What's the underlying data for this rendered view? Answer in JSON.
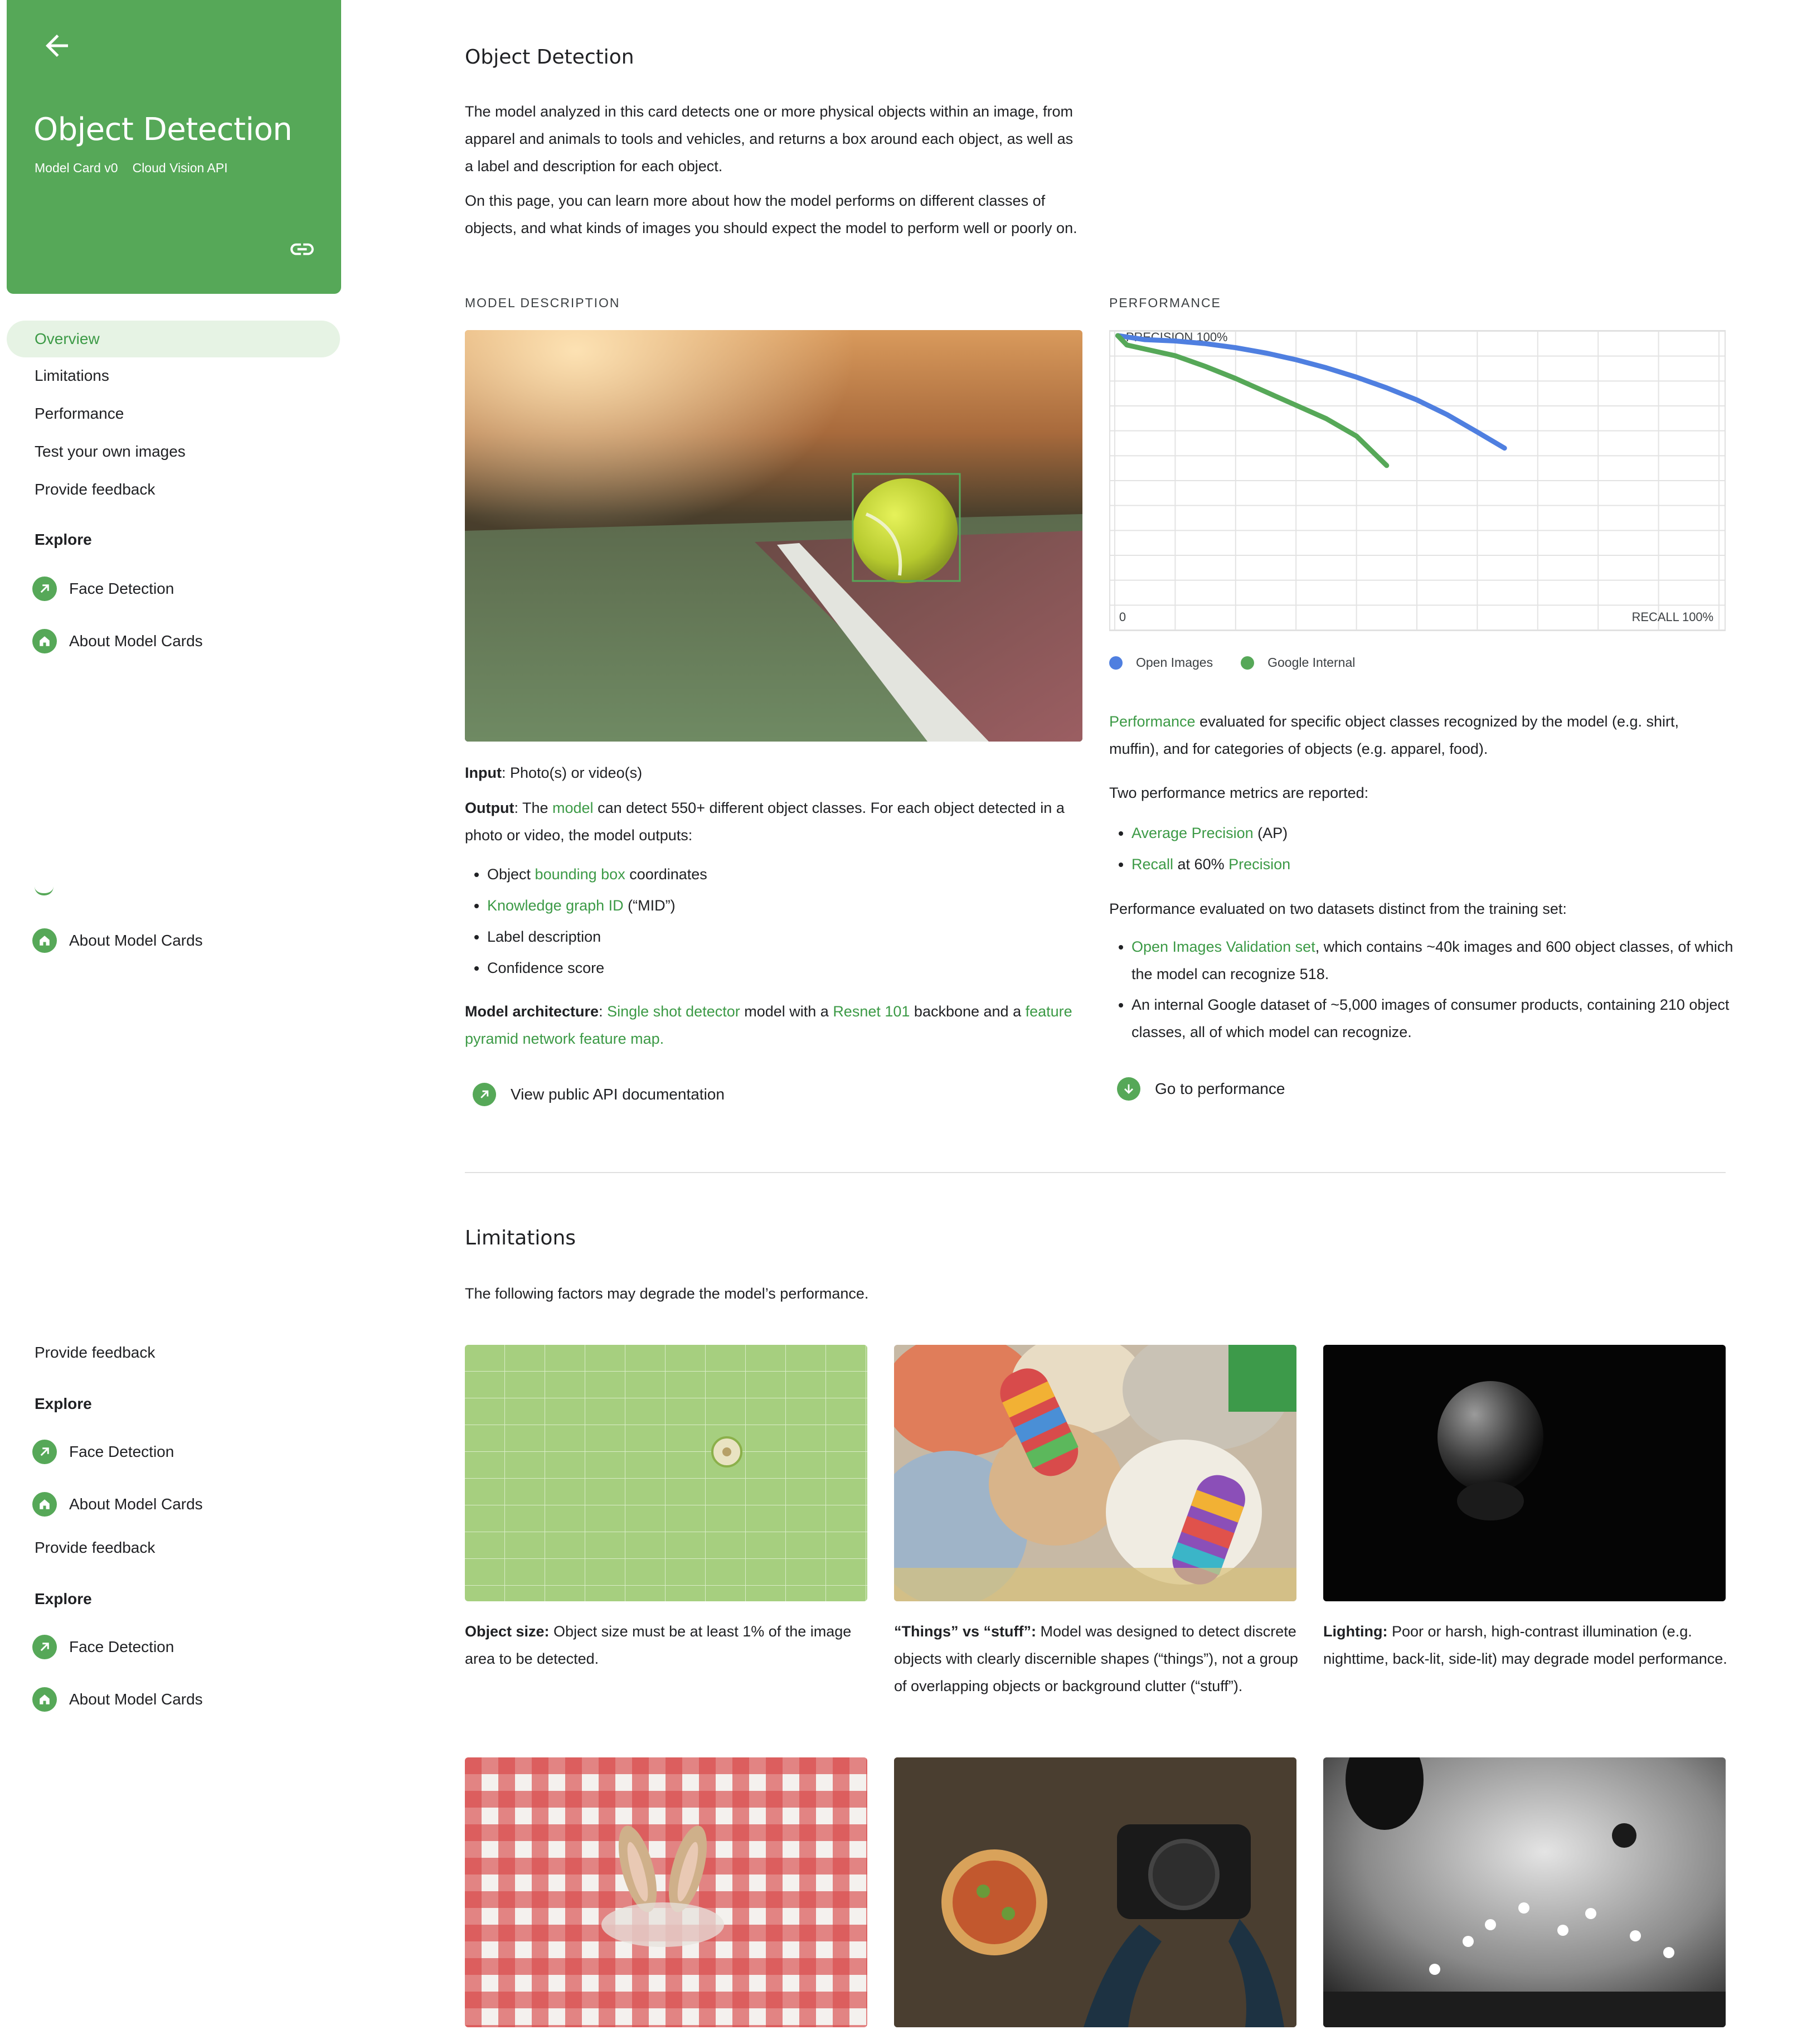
{
  "hero": {
    "title": "Object Detection",
    "meta": [
      "Model Card v0",
      "Cloud Vision API"
    ]
  },
  "nav": {
    "items": [
      "Overview",
      "Limitations",
      "Performance",
      "Test your own images",
      "Provide feedback"
    ],
    "explore_heading": "Explore",
    "explore_links": [
      "Face Detection",
      "About Model Cards"
    ]
  },
  "overview": {
    "title": "Object Detection",
    "intro": [
      "The model analyzed in this card detects one or more physical objects within an image, from apparel and animals to tools and vehicles, and returns a box around each object, as well as a label and description for each object.",
      "On this page, you can learn more about how the model performs on different classes of objects, and what kinds of images you should expect the model to perform well or poorly on."
    ]
  },
  "model_description": {
    "heading": "MODEL DESCRIPTION",
    "input_label": "Input",
    "input_text": ": Photo(s) or video(s)",
    "output_label": "Output",
    "output_pre": ": The ",
    "output_link": "model",
    "output_post": " can detect 550+ different object classes. For each object detected in a photo or video, the model outputs:",
    "outputs": [
      {
        "pre": "Object ",
        "link": "bounding box",
        "post": " coordinates"
      },
      {
        "pre": "",
        "link": "Knowledge graph ID",
        "post": " (“MID”)"
      },
      {
        "pre": "Label description",
        "link": "",
        "post": ""
      },
      {
        "pre": "Confidence score",
        "link": "",
        "post": ""
      }
    ],
    "arch_label": "Model architecture",
    "arch_sep": ": ",
    "arch_link1": "Single shot detector",
    "arch_mid": " model with a ",
    "arch_link2": "Resnet 101",
    "arch_mid2": " backbone and a ",
    "arch_link3": "feature pyramid network feature map.",
    "cta": "View public API documentation"
  },
  "performance": {
    "heading": "PERFORMANCE",
    "p1_link": "Performance",
    "p1_text": " evaluated for specific object classes recognized by the model (e.g. shirt, muffin), and for categories of objects (e.g. apparel, food).",
    "p2": "Two performance metrics are reported:",
    "metrics": [
      {
        "link": "Average Precision",
        "post": " (AP)",
        "mid": "",
        "link2": ""
      },
      {
        "link": "Recall",
        "post": "",
        "mid": " at 60% ",
        "link2": "Precision"
      }
    ],
    "p3": "Performance evaluated on two datasets distinct from the training set:",
    "datasets": [
      {
        "link": "Open Images Validation set",
        "post": ", which contains ~40k images and 600 object classes, of which the model can recognize 518."
      },
      {
        "link": "",
        "post": "An internal Google dataset of ~5,000 images of consumer products, containing 210 object classes, all of which model can recognize."
      }
    ],
    "cta": "Go to performance"
  },
  "chart_data": {
    "type": "line",
    "ylabel": "PRECISION 100%",
    "xlabel": "RECALL 100%",
    "x_origin_label": "0",
    "xlim": [
      0,
      100
    ],
    "ylim": [
      0,
      100
    ],
    "grid": true,
    "legend_position": "bottom-left",
    "series": [
      {
        "name": "Open Images",
        "color": "#4f7fe0",
        "x": [
          0.5,
          5,
          10,
          15,
          20,
          25,
          30,
          35,
          40,
          45,
          50,
          55,
          60,
          64.5
        ],
        "y": [
          100,
          98.5,
          98,
          97,
          95.5,
          93.5,
          91,
          88,
          84.5,
          80.5,
          76,
          70.5,
          64,
          58
        ]
      },
      {
        "name": "Google Internal",
        "color": "#56a858",
        "x": [
          0.5,
          2,
          5,
          10,
          15,
          20,
          25,
          30,
          35,
          40,
          45
        ],
        "y": [
          100,
          96.5,
          95,
          92.5,
          88.5,
          84,
          79,
          74,
          69,
          62.5,
          51.5
        ]
      }
    ]
  },
  "limitations": {
    "title": "Limitations",
    "intro": "The following factors may degrade the model’s performance.",
    "items": [
      {
        "label": "Object size:",
        "text": " Object size must be at least 1% of the image area to be detected."
      },
      {
        "label": "“Things” vs “stuff”:",
        "text": " Model was designed to detect discrete objects with clearly discernible shapes (“things”), not a group of overlapping objects or background clutter (“stuff”)."
      },
      {
        "label": "Lighting:",
        "text": " Poor or harsh, high-contrast illumination (e.g. nighttime, back-lit, side-lit) may degrade model performance."
      }
    ]
  },
  "colors": {
    "accent": "#56a858",
    "link": "#3c9a46",
    "blue_series": "#4f7fe0"
  }
}
